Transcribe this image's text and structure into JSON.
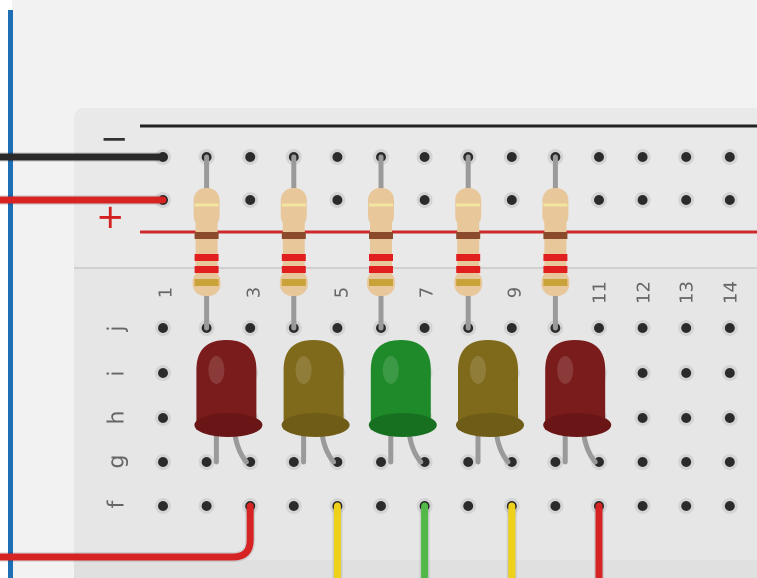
{
  "app": {
    "background": "#f2f2f2",
    "board_color": "#e9e9e9",
    "rail_negative_color": "#222222",
    "rail_positive_color": "#cc2a2a",
    "sidebar_accent": "#1f6fb5"
  },
  "rails": {
    "negative_sign": "−",
    "positive_sign": "+"
  },
  "column_labels": [
    "1",
    "3",
    "5",
    "7",
    "9",
    "11",
    "12",
    "13",
    "14"
  ],
  "row_labels": [
    "j",
    "i",
    "h",
    "g",
    "f"
  ],
  "components": {
    "resistors": [
      {
        "name": "resistor-1",
        "bands": [
          "#8b4a2b",
          "#e21f1f",
          "#e21f1f",
          "#c9a23a"
        ]
      },
      {
        "name": "resistor-2",
        "bands": [
          "#8b4a2b",
          "#e21f1f",
          "#e21f1f",
          "#c9a23a"
        ]
      },
      {
        "name": "resistor-3",
        "bands": [
          "#8b4a2b",
          "#e21f1f",
          "#e21f1f",
          "#c9a23a"
        ]
      },
      {
        "name": "resistor-4",
        "bands": [
          "#8b4a2b",
          "#e21f1f",
          "#e21f1f",
          "#c9a23a"
        ]
      },
      {
        "name": "resistor-5",
        "bands": [
          "#8b4a2b",
          "#e21f1f",
          "#e21f1f",
          "#c9a23a"
        ]
      }
    ],
    "leds": [
      {
        "name": "led-red-1",
        "color": "red",
        "body": "#7a1c1c",
        "rim": "#6a1616"
      },
      {
        "name": "led-yellow-1",
        "color": "yellow",
        "body": "#7f6a1c",
        "rim": "#6f5c16"
      },
      {
        "name": "led-green",
        "color": "green",
        "body": "#1f8a2a",
        "rim": "#167020"
      },
      {
        "name": "led-yellow-2",
        "color": "yellow",
        "body": "#7f6a1c",
        "rim": "#6f5c16"
      },
      {
        "name": "led-red-2",
        "color": "red",
        "body": "#7a1c1c",
        "rim": "#6a1616"
      }
    ],
    "wires": [
      {
        "name": "wire-black-negative",
        "color": "#2a2a2a"
      },
      {
        "name": "wire-red-positive",
        "color": "#d62424"
      },
      {
        "name": "wire-red-ground",
        "color": "#d62424"
      },
      {
        "name": "wire-yellow-1",
        "color": "#f0d11a"
      },
      {
        "name": "wire-green",
        "color": "#52b848"
      },
      {
        "name": "wire-yellow-2",
        "color": "#f0d11a"
      },
      {
        "name": "wire-red-2",
        "color": "#d62424"
      }
    ]
  }
}
